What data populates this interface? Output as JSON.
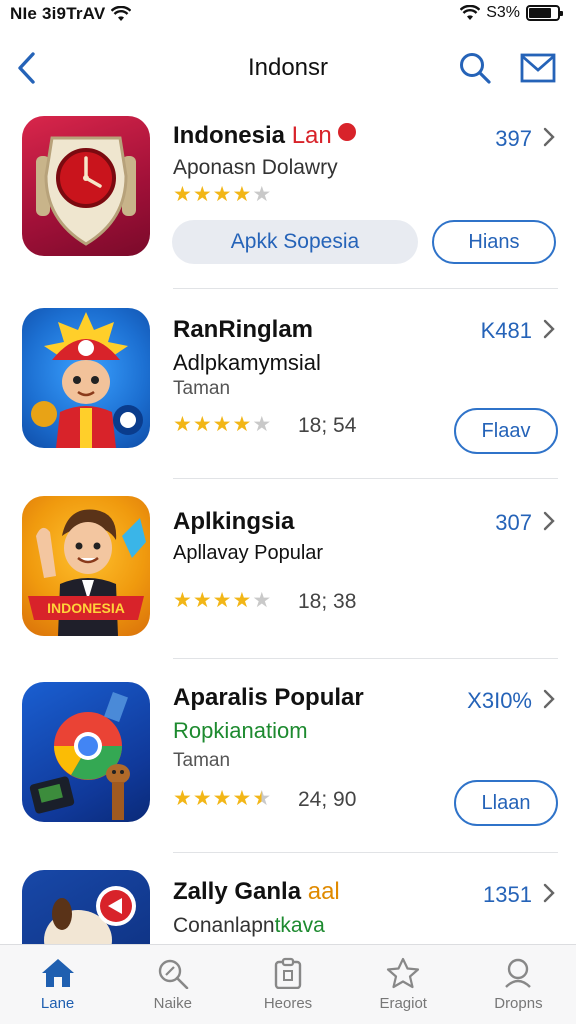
{
  "status_bar": {
    "left_text": "NIe 3i9TrAV",
    "battery_text": "S3%",
    "battery_level": 0.8
  },
  "nav": {
    "title": "Indonsr"
  },
  "apps": [
    {
      "title": "Indonesia",
      "title_tag": "Lan",
      "subtitle": "Aponasn Dolawry",
      "category": "",
      "stars": 4,
      "rating_count": "",
      "meta": "397",
      "primary_button": "Apkk Sopesia",
      "secondary_button": "Hians"
    },
    {
      "title": "RanRinglam",
      "subtitle": "Adlpkamymsial",
      "category": "Taman",
      "stars": 4,
      "rating_count": "18; 54",
      "meta": "K481",
      "button": "Flaav"
    },
    {
      "title": "Aplkingsia",
      "subtitle": "Apllavay Popular",
      "category": "",
      "stars": 4,
      "rating_count": "18; 38",
      "meta": "307",
      "icon_banner": "INDONESIA"
    },
    {
      "title": "Aparalis Popular",
      "subtitle": "Ropkianatiom",
      "category": "Taman",
      "stars": 4.5,
      "rating_count": "24; 90",
      "meta": "X3I0%",
      "button": "Llaan"
    },
    {
      "title": "Zally Ganla",
      "title_tag": "aal",
      "subtitle": "Conanlapn",
      "subtitle_tag": "tkava",
      "meta": "1351"
    }
  ],
  "tabs": [
    {
      "label": "Lane",
      "icon": "home-icon",
      "active": true
    },
    {
      "label": "Naike",
      "icon": "rocket-icon",
      "active": false
    },
    {
      "label": "Heores",
      "icon": "store-icon",
      "active": false
    },
    {
      "label": "Eragiot",
      "icon": "star-icon",
      "active": false
    },
    {
      "label": "Dropns",
      "icon": "search-icon",
      "active": false
    }
  ],
  "colors": {
    "accent": "#2563b8",
    "star": "#f2b617",
    "tag_red": "#d8232a",
    "tag_green": "#1d8a2f"
  }
}
